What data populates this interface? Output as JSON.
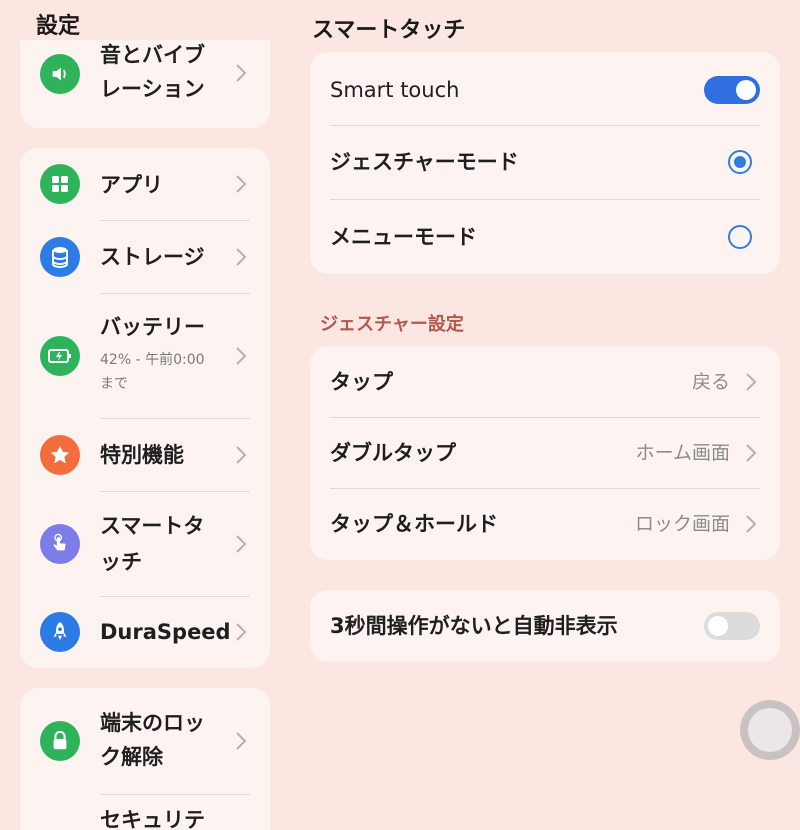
{
  "left": {
    "title": "設定",
    "items": [
      {
        "label": "音とバイブ\nレーション",
        "icon": "speaker-icon",
        "color": "#2fb35a"
      },
      {
        "label": "アプリ",
        "icon": "apps-grid-icon",
        "color": "#2fb35a"
      },
      {
        "label": "ストレージ",
        "icon": "storage-icon",
        "color": "#2d7be4"
      },
      {
        "label": "バッテリー",
        "sub": "42% - 午前0:00\nまで",
        "icon": "battery-icon",
        "color": "#2fb35a"
      },
      {
        "label": "特別機能",
        "icon": "star-icon",
        "color": "#f36c3d"
      },
      {
        "label": "スマートタ\nッチ",
        "icon": "touch-hand-icon",
        "color": "#7d7ce8"
      },
      {
        "label": "DuraSpeed",
        "icon": "rocket-icon",
        "color": "#2d7be4"
      },
      {
        "label": "端末のロッ\nク解除",
        "icon": "lock-icon",
        "color": "#2fb35a"
      },
      {
        "label": "セキュリテ",
        "icon": "",
        "color": ""
      }
    ]
  },
  "right": {
    "title": "スマートタッチ",
    "mode_card": {
      "smart_touch_label": "Smart touch",
      "smart_touch_on": true,
      "gesture_mode_label": "ジェスチャーモード",
      "gesture_mode_selected": true,
      "menu_mode_label": "メニューモード",
      "menu_mode_selected": false
    },
    "gesture_section_label": "ジェスチャー設定",
    "gesture_card": [
      {
        "label": "タップ",
        "value": "戻る"
      },
      {
        "label": "ダブルタップ",
        "value": "ホーム画面"
      },
      {
        "label": "タップ＆ホールド",
        "value": "ロック画面"
      }
    ],
    "auto_hide": {
      "label": "3秒間操作がないと自動非表示",
      "on": false
    }
  },
  "colors": {
    "background": "#fbe6e2",
    "card": "#fdf4f2",
    "accent": "#2f6fe0",
    "section_label": "#b05a4f"
  }
}
